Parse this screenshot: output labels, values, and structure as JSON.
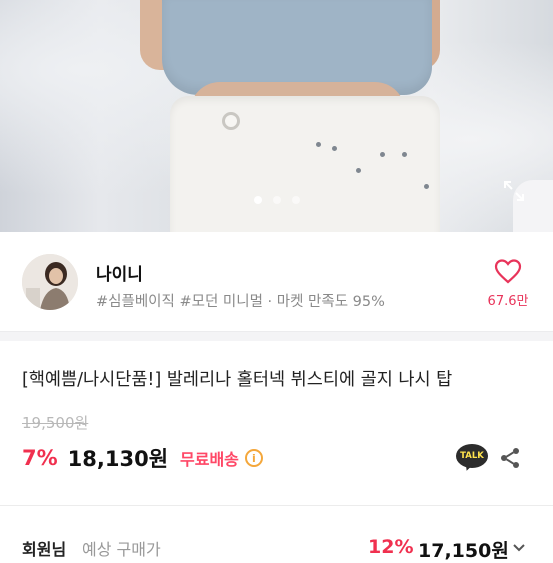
{
  "hero": {
    "carousel": {
      "total_slides": 3,
      "active_index": 0
    },
    "expand_icon": "expand-icon"
  },
  "seller": {
    "name": "나이니",
    "tags": "#심플베이직 #모던 미니멀 · 마켓 만족도 95%",
    "like_count": "67.6만"
  },
  "product": {
    "title": "[핵예쁨/나시단품!] 발레리나 홀터넥 뷔스티에 골지 나시 탑",
    "original_price": "19,500원",
    "discount": "7%",
    "price": "18,130원",
    "shipping": "무료배송",
    "talk_label": "TALK"
  },
  "member_price": {
    "label": "회원님",
    "sub": "예상 구매가",
    "discount": "12%",
    "price": "17,150원"
  },
  "colors": {
    "accent_pink": "#f0304f",
    "heart": "#e8345a",
    "shipping": "#ff4766",
    "info": "#f4a73b"
  }
}
